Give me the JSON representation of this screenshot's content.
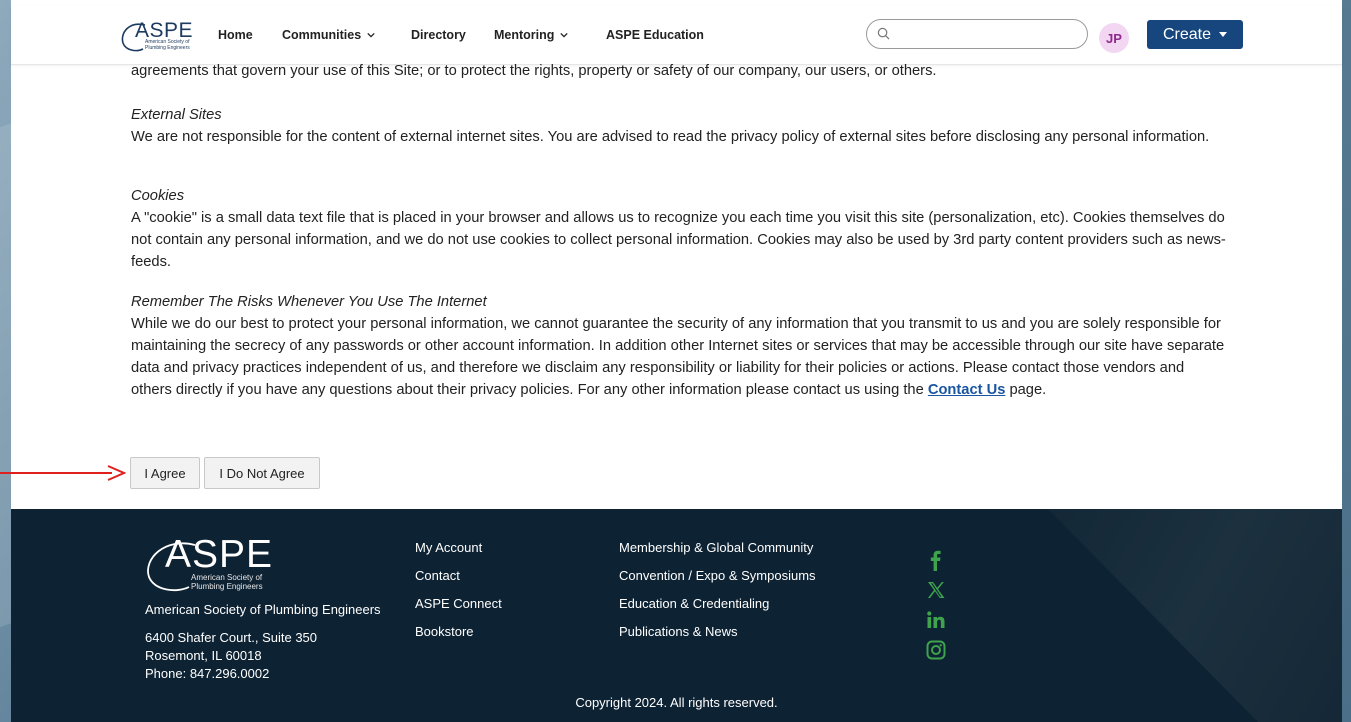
{
  "nav": {
    "logo_text": "ASPE",
    "logo_sub": "American Society of Plumbing Engineers",
    "items": [
      {
        "label": "Home"
      },
      {
        "label": "Communities"
      },
      {
        "label": "Directory"
      },
      {
        "label": "Mentoring"
      },
      {
        "label": "ASPE Education"
      }
    ],
    "search_placeholder": "",
    "avatar_initials": "JP",
    "create_label": "Create"
  },
  "content": {
    "top_line": "agreements that govern your use of this Site; or to protect the rights, property or safety of our company, our users, or others.",
    "sections": [
      {
        "heading": "External Sites",
        "body": "We are not responsible for the content of external internet sites. You are advised to read the privacy policy of external sites before disclosing any personal information."
      },
      {
        "heading": "Cookies",
        "body": "A \"cookie\" is a small data text file that is placed in your browser and allows us to recognize you each time you visit this site (personalization, etc). Cookies themselves do not contain any personal information, and we do not use cookies to collect personal information. Cookies may also be used by 3rd party content providers such as news-feeds."
      },
      {
        "heading": "Remember The Risks Whenever You Use The Internet",
        "body": "While we do our best to protect your personal information, we cannot guarantee the security of any information that you transmit to us and you are solely responsible for maintaining the secrecy of any passwords or other account information. In addition other Internet sites or services that may be accessible through our site have separate data and privacy practices independent of us, and therefore we disclaim any responsibility or liability for their policies or actions. Please contact those vendors and others directly if you have any questions about their privacy policies.  For any other information please contact us using the",
        "link_text": "Contact Us",
        "tail": "page."
      }
    ],
    "agree_label": "I Agree",
    "disagree_label": "I Do Not Agree"
  },
  "footer": {
    "logo_text": "ASPE",
    "logo_sub": "American Society of Plumbing Engineers",
    "org_name": "American Society of Plumbing Engineers",
    "address_line1": "6400 Shafer Court., Suite 350",
    "address_line2": "Rosemont, IL 60018",
    "phone": "Phone: 847.296.0002",
    "col1": [
      "My Account",
      "Contact",
      "ASPE Connect",
      "Bookstore"
    ],
    "col2": [
      "Membership & Global Community",
      "Convention / Expo & Symposiums",
      "Education & Credentialing",
      "Publications & News"
    ],
    "social_icons": [
      "facebook-icon",
      "x-icon",
      "linkedin-icon",
      "instagram-icon"
    ],
    "social_color": "#3fa34d",
    "copyright": "Copyright 2024. All rights reserved."
  },
  "colors": {
    "brand_navy": "#16467d",
    "footer_bg": "#0d2233",
    "arrow": "#e0201e",
    "link": "#1a55a0"
  }
}
